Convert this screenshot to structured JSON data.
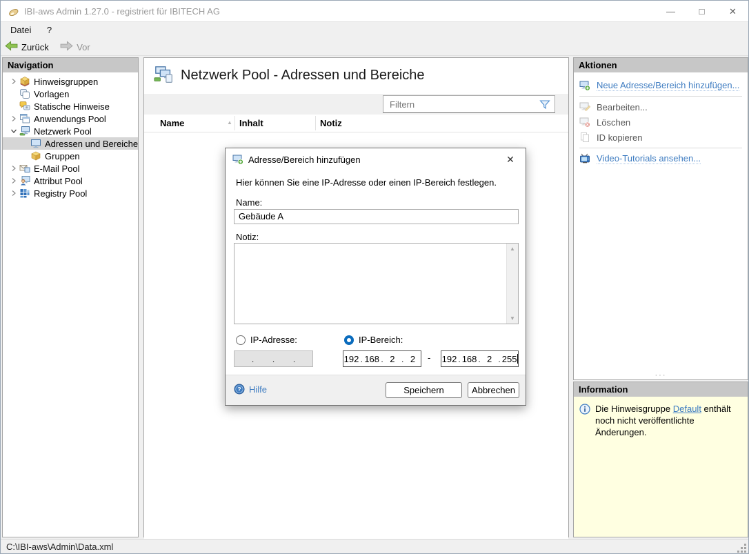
{
  "window": {
    "title": "IBI-aws Admin 1.27.0 - registriert für IBITECH AG",
    "controls": {
      "minimize": "—",
      "maximize": "□",
      "close": "✕"
    }
  },
  "menubar": {
    "items": [
      {
        "label": "Datei"
      },
      {
        "label": "?"
      }
    ]
  },
  "toolbar": {
    "back_label": "Zurück",
    "forward_label": "Vor"
  },
  "navigation": {
    "header": "Navigation",
    "items": [
      {
        "label": "Hinweisgruppen",
        "icon": "box-stack-icon",
        "state": "collapsed",
        "level": 0,
        "selected": false
      },
      {
        "label": "Vorlagen",
        "icon": "templates-icon",
        "state": "none",
        "level": 0,
        "selected": false
      },
      {
        "label": "Statische Hinweise",
        "icon": "static-notes-icon",
        "state": "none",
        "level": 0,
        "selected": false
      },
      {
        "label": "Anwendungs Pool",
        "icon": "app-windows-icon",
        "state": "collapsed",
        "level": 0,
        "selected": false
      },
      {
        "label": "Netzwerk Pool",
        "icon": "network-monitor-icon",
        "state": "expanded",
        "level": 0,
        "selected": false
      },
      {
        "label": "Adressen und Bereiche",
        "icon": "monitor-icon",
        "state": "none",
        "level": 1,
        "selected": true
      },
      {
        "label": "Gruppen",
        "icon": "box-icon",
        "state": "none",
        "level": 1,
        "selected": false
      },
      {
        "label": "E-Mail Pool",
        "icon": "email-icon",
        "state": "collapsed",
        "level": 0,
        "selected": false
      },
      {
        "label": "Attribut Pool",
        "icon": "person-monitor-icon",
        "state": "collapsed",
        "level": 0,
        "selected": false
      },
      {
        "label": "Registry Pool",
        "icon": "registry-grid-icon",
        "state": "collapsed",
        "level": 0,
        "selected": false
      }
    ]
  },
  "main": {
    "title": "Netzwerk Pool - Adressen und Bereiche",
    "filter_placeholder": "Filtern",
    "table": {
      "columns": [
        "Name",
        "Inhalt",
        "Notiz"
      ],
      "sort_column": "Name",
      "sort_direction": "asc",
      "rows": []
    }
  },
  "dialog": {
    "title": "Adresse/Bereich hinzufügen",
    "description": "Hier können Sie eine IP-Adresse oder einen IP-Bereich festlegen.",
    "name_label": "Name:",
    "name_value": "Gebäude A",
    "note_label": "Notiz:",
    "note_value": "",
    "ip_address_label": "IP-Adresse:",
    "ip_range_label": "IP-Bereich:",
    "selected_option": "IP-Bereich",
    "range_separator": "-",
    "ip_from": [
      "192",
      "168",
      "2",
      "2"
    ],
    "ip_to": [
      "192",
      "168",
      "2",
      "255"
    ],
    "help_label": "Hilfe",
    "save_label": "Speichern",
    "cancel_label": "Abbrechen"
  },
  "actions": {
    "header": "Aktionen",
    "items": [
      {
        "label": "Neue Adresse/Bereich hinzufügen...",
        "icon": "monitor-add-icon",
        "enabled": true
      },
      {
        "label": "Bearbeiten...",
        "icon": "monitor-edit-icon",
        "enabled": false
      },
      {
        "label": "Löschen",
        "icon": "monitor-delete-icon",
        "enabled": false
      },
      {
        "label": "ID kopieren",
        "icon": "copy-icon",
        "enabled": false
      },
      {
        "label": "Video-Tutorials ansehen...",
        "icon": "tv-icon",
        "enabled": true
      }
    ]
  },
  "information": {
    "header": "Information",
    "message_before": "Die Hinweisgruppe ",
    "link_label": "Default",
    "message_after": " enthält noch nicht veröffentlichte Änderungen."
  },
  "statusbar": {
    "path": "C:\\IBI-aws\\Admin\\Data.xml"
  },
  "icons": {
    "sort_asc": "▲",
    "scroll_up": "▲",
    "scroll_down": "▼",
    "splitter_grip": "···"
  },
  "colors": {
    "link_blue": "#3e7cc1",
    "selected_row": "#d6d6d6",
    "header_strip": "#c7c7c7",
    "info_panel_bg": "#ffffe1",
    "radio_checked": "#0b6cbd",
    "back_arrow_green": "#8fc350"
  }
}
